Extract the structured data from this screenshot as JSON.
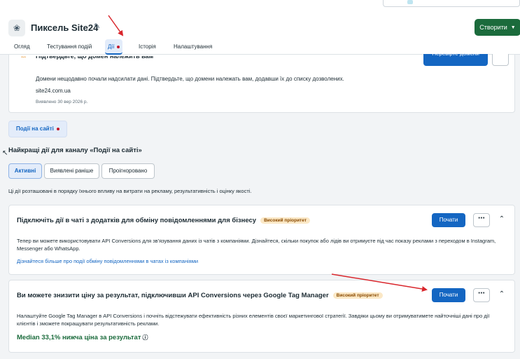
{
  "header": {
    "title": "Пиксель Site24",
    "app_icon": "pixel-icon",
    "edit_icon": "pencil-icon",
    "create_button": "Створити",
    "tabs": [
      {
        "label": "Огляд"
      },
      {
        "label": "Тестування подій"
      },
      {
        "label": "Дії",
        "active": true
      },
      {
        "label": "Історія"
      },
      {
        "label": "Налаштування"
      }
    ]
  },
  "domain_card": {
    "title": "Підтвердьте, що домен належить вам",
    "verify_button": "Перевірте домени",
    "description": "Домени нещодавно почали надсилати дані. Підтвердьте, що домени належать вам, додавши їх до списку дозволених.",
    "domain": "site24.com.ua",
    "detected": "Виявлено 30 вер 2026 р."
  },
  "filter_chip": "Події на сайті",
  "section_title": "Найкращі дії для каналу «Події на сайті»",
  "segments": [
    {
      "label": "Активні",
      "active": true
    },
    {
      "label": "Виявлені раніше"
    },
    {
      "label": "Проігноровано"
    }
  ],
  "info_line": "Ці дії розташовані в порядку їхнього впливу на витрати на рекламу, результативність і оцінку якості.",
  "recommendations": [
    {
      "title": "Підключіть дії в чаті з додатків для обміну повідомленнями для бізнесу",
      "badge": "Високий пріоритет",
      "start_button": "Почати",
      "description": "Тепер ви можете використовувати API Conversions для зв'язування даних із чатів з компаніями. Дізнайтеся, скільки покупок або лідів ви отримуєте під час показу реклами з переходом в Instagram, Messenger або WhatsApp.",
      "link": "Дізнайтеся більше про події обміну повідомленнями в чатах із компаніями"
    },
    {
      "title": "Ви можете знизити ціну за результат, підключивши API Conversions через Google Tag Manager",
      "badge": "Високий пріоритет",
      "start_button": "Почати",
      "description": "Налаштуйте Google Tag Manager в API Conversions і почніть відстежувати ефективність різних елементів своєї маркетингової стратегії. Завдяки цьому ви отримуватимете найточніші дані про дії клієнтів і зможете покращувати результативність реклами.",
      "median": "Median 33,1% нижча ціна за результат"
    }
  ],
  "colors": {
    "accent": "#1466c2",
    "create": "#1b6b3c",
    "annotation_arrow": "#d9262c"
  }
}
